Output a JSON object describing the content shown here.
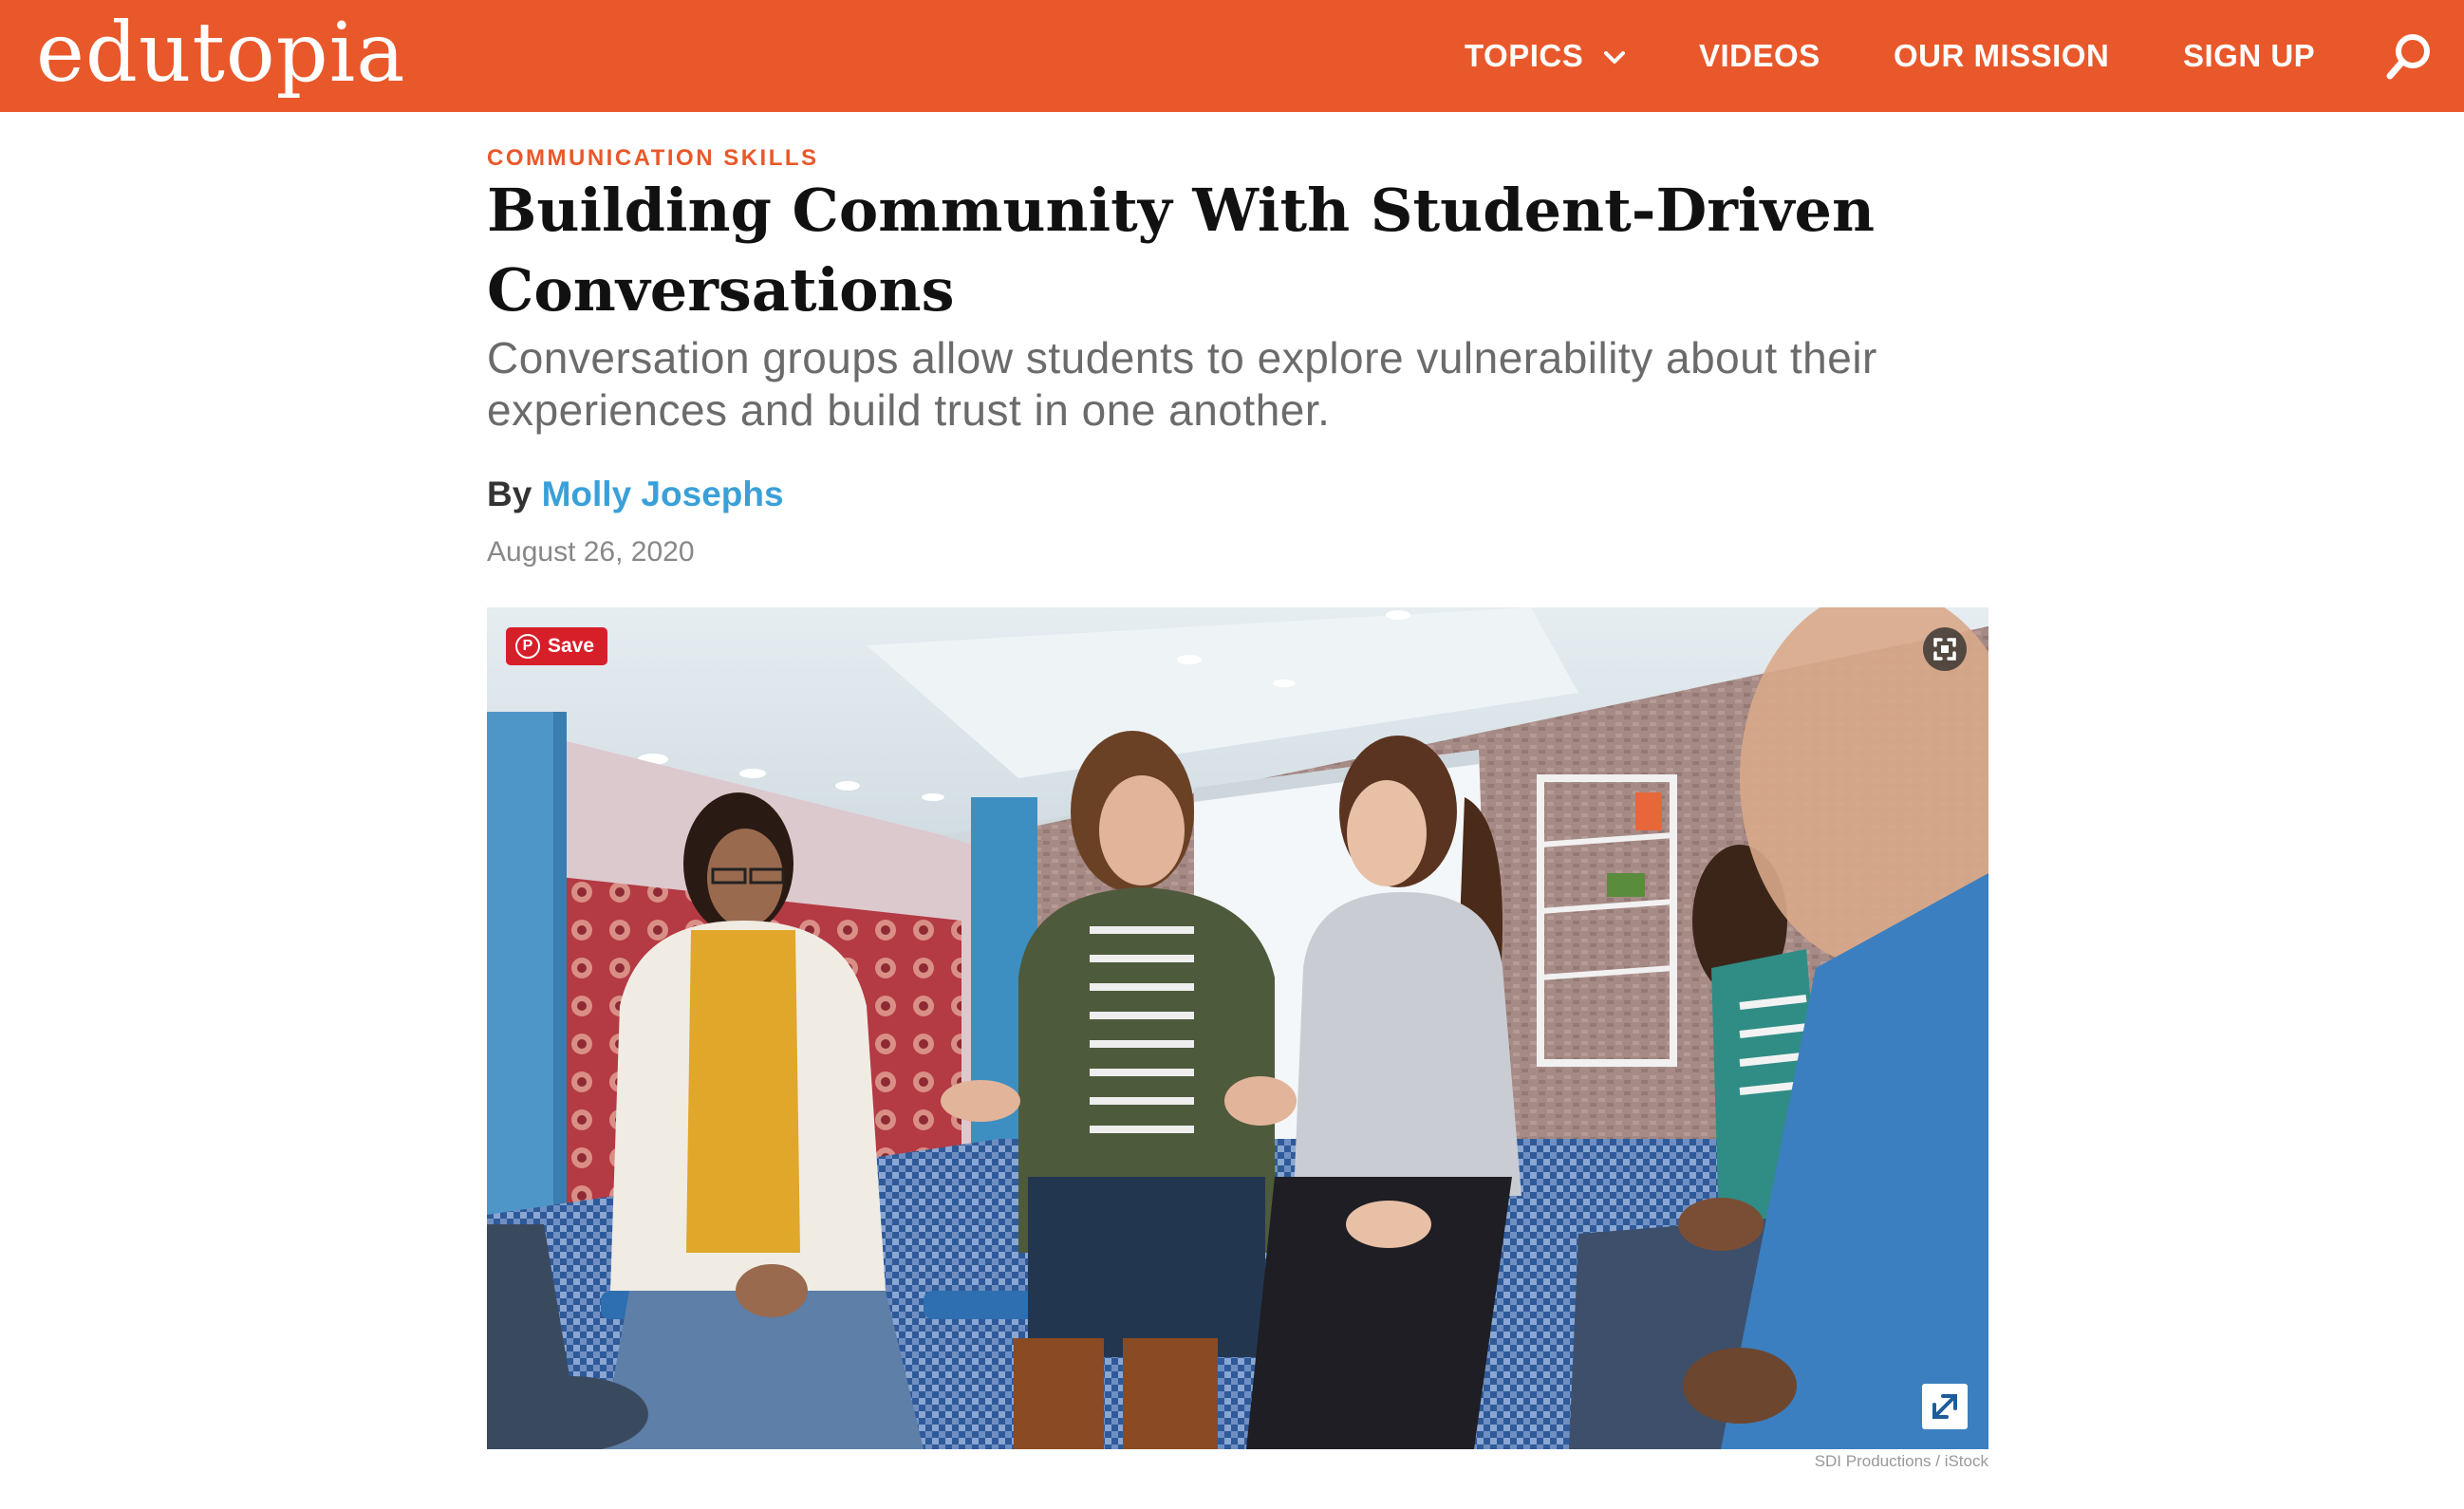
{
  "header": {
    "logo_text": "edutopia",
    "nav": {
      "topics": "TOPICS",
      "videos": "VIDEOS",
      "our_mission": "OUR MISSION",
      "sign_up": "SIGN UP"
    },
    "icons": {
      "dropdown": "chevron-down-icon",
      "search": "search-icon"
    },
    "brand_color": "#e9582a"
  },
  "article": {
    "kicker": "COMMUNICATION SKILLS",
    "title": "Building Community With Student-Driven Conversations",
    "dek": "Conversation groups allow students to explore vulnerability about their experiences and build trust in one another.",
    "byline_prefix": "By",
    "author": "Molly Josephs",
    "date": "August 26, 2020",
    "author_color": "#3aa0d8"
  },
  "hero": {
    "pin_save_label": "Save",
    "pin_logo": "P",
    "credit": "SDI Productions / iStock",
    "icons": {
      "pin": "pinterest-icon",
      "focus": "focus-icon",
      "expand": "expand-icon"
    },
    "pin_color": "#d71f2a"
  }
}
